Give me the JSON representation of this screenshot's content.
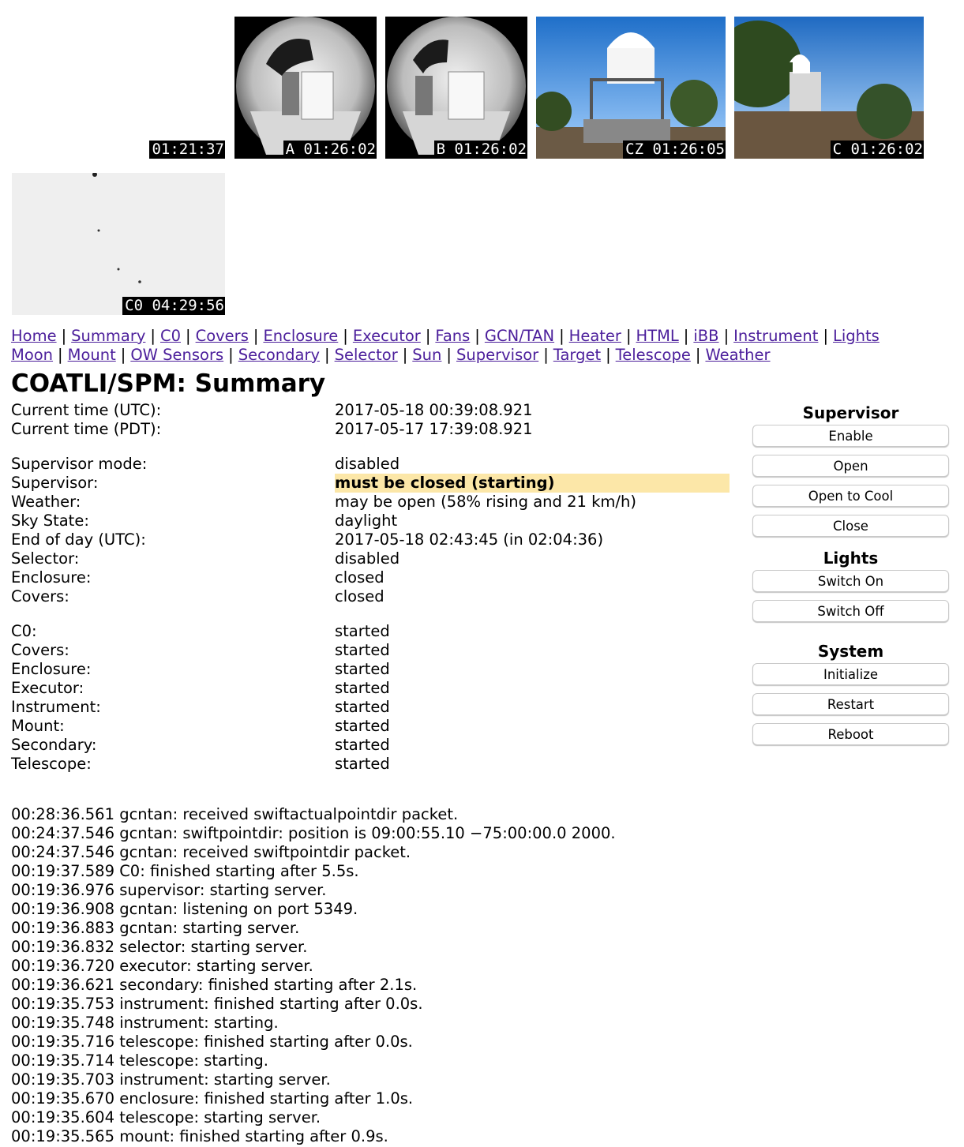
{
  "cameras": [
    {
      "id": "blank",
      "label": "01:21:37"
    },
    {
      "id": "a",
      "label": "A 01:26:02"
    },
    {
      "id": "b",
      "label": "B 01:26:02"
    },
    {
      "id": "cz",
      "label": "CZ 01:26:05"
    },
    {
      "id": "c",
      "label": "C 01:26:02"
    },
    {
      "id": "c0",
      "label": "C0 04:29:56"
    }
  ],
  "nav": {
    "line1": [
      "Home",
      "Summary",
      "C0",
      "Covers",
      "Enclosure",
      "Executor",
      "Fans",
      "GCN/TAN",
      "Heater",
      "HTML",
      "iBB",
      "Instrument",
      "Lights"
    ],
    "line2": [
      "Moon",
      "Mount",
      "OW Sensors",
      "Secondary",
      "Selector",
      "Sun",
      "Supervisor",
      "Target",
      "Telescope",
      "Weather"
    ],
    "separator": "|"
  },
  "page_title": "COATLI/SPM: Summary",
  "status": {
    "time": [
      {
        "key": "Current time (UTC):",
        "value": "2017-05-18 00:39:08.921"
      },
      {
        "key": "Current time (PDT):",
        "value": "2017-05-17 17:39:08.921"
      }
    ],
    "state": [
      {
        "key": "Supervisor mode:",
        "value": "disabled"
      },
      {
        "key": "Supervisor:",
        "value": "must be closed (starting)"
      },
      {
        "key": "Weather:",
        "value": "may be open (58% rising and 21 km/h)"
      },
      {
        "key": "Sky State:",
        "value": "daylight"
      },
      {
        "key": "End of day (UTC):",
        "value": "2017-05-18 02:43:45 (in 02:04:36)"
      },
      {
        "key": "Selector:",
        "value": "disabled"
      },
      {
        "key": "Enclosure:",
        "value": "closed"
      },
      {
        "key": "Covers:",
        "value": "closed"
      }
    ],
    "services": [
      {
        "key": "C0:",
        "value": "started"
      },
      {
        "key": "Covers:",
        "value": "started"
      },
      {
        "key": "Enclosure:",
        "value": "started"
      },
      {
        "key": "Executor:",
        "value": "started"
      },
      {
        "key": "Instrument:",
        "value": "started"
      },
      {
        "key": "Mount:",
        "value": "started"
      },
      {
        "key": "Secondary:",
        "value": "started"
      },
      {
        "key": "Telescope:",
        "value": "started"
      }
    ],
    "highlight_color": "#fce7a8"
  },
  "controls": {
    "supervisor": {
      "title": "Supervisor",
      "buttons": [
        "Enable",
        "Open",
        "Open to Cool",
        "Close"
      ]
    },
    "lights": {
      "title": "Lights",
      "buttons": [
        "Switch On",
        "Switch Off"
      ]
    },
    "system": {
      "title": "System",
      "buttons": [
        "Initialize",
        "Restart",
        "Reboot"
      ]
    }
  },
  "log": [
    "00:28:36.561 gcntan: received swiftactualpointdir packet.",
    "00:24:37.546 gcntan: swiftpointdir: position is 09:00:55.10 −75:00:00.0 2000.",
    "00:24:37.546 gcntan: received swiftpointdir packet.",
    "00:19:37.589 C0: finished starting after 5.5s.",
    "00:19:36.976 supervisor: starting server.",
    "00:19:36.908 gcntan: listening on port 5349.",
    "00:19:36.883 gcntan: starting server.",
    "00:19:36.832 selector: starting server.",
    "00:19:36.720 executor: starting server.",
    "00:19:36.621 secondary: finished starting after 2.1s.",
    "00:19:35.753 instrument: finished starting after 0.0s.",
    "00:19:35.748 instrument: starting.",
    "00:19:35.716 telescope: finished starting after 0.0s.",
    "00:19:35.714 telescope: starting.",
    "00:19:35.703 instrument: starting server.",
    "00:19:35.670 enclosure: finished starting after 1.0s.",
    "00:19:35.604 telescope: starting server.",
    "00:19:35.565 mount: finished starting after 0.9s."
  ],
  "nav_link_color": "#4b1e9b"
}
